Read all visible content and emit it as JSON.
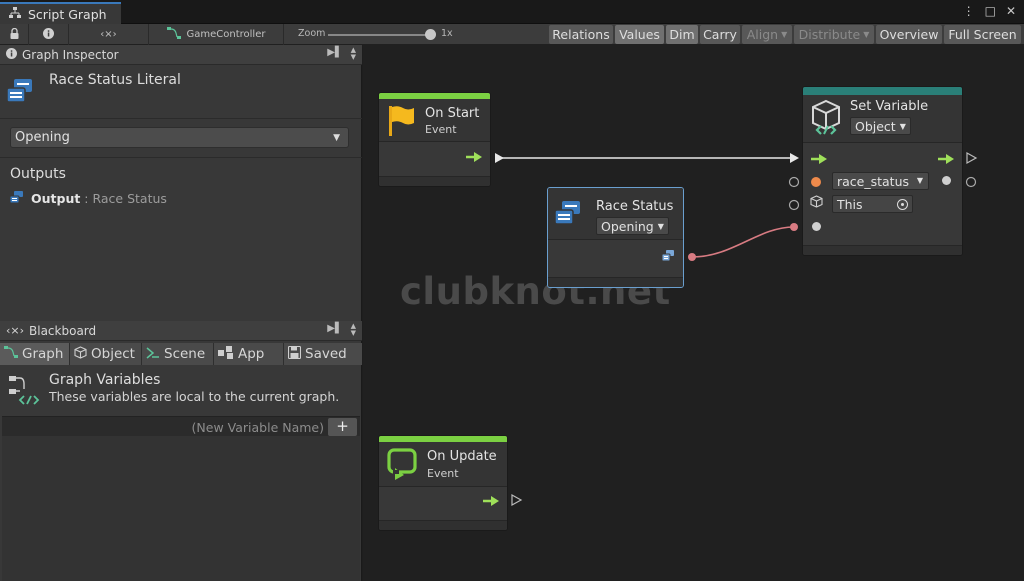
{
  "window": {
    "tab_title": "Script Graph",
    "controls": {
      "more": "⋮",
      "maximize": "□",
      "close": "✕"
    }
  },
  "toolbar": {
    "lock_icon": "lock-icon",
    "info_icon": "info-icon",
    "variables_icon": "‹×›",
    "target_name": "GameController",
    "zoom_label": "Zoom",
    "zoom_value": "1x",
    "buttons": {
      "relations": "Relations",
      "values": "Values",
      "dim": "Dim",
      "carry": "Carry",
      "align": "Align",
      "distribute": "Distribute",
      "overview": "Overview",
      "full_screen": "Full Screen"
    }
  },
  "inspector": {
    "header": "Graph Inspector",
    "title": "Race Status Literal",
    "dropdown_value": "Opening",
    "outputs_label": "Outputs",
    "output_name": "Output",
    "output_type": " : Race Status"
  },
  "blackboard": {
    "header": "Blackboard",
    "tabs": [
      "Graph",
      "Object",
      "Scene",
      "App",
      "Saved"
    ],
    "active_tab": "Graph",
    "section_title": "Graph Variables",
    "section_desc": "These variables are local to the current graph.",
    "new_var_placeholder": "(New Variable Name)",
    "add_label": "+"
  },
  "nodes": {
    "on_start": {
      "title": "On Start",
      "subtitle": "Event"
    },
    "set_variable": {
      "title": "Set Variable",
      "kind": "Object",
      "name": "race_status",
      "target": "This"
    },
    "race_status": {
      "title": "Race Status",
      "value": "Opening"
    },
    "on_update": {
      "title": "On Update",
      "subtitle": "Event"
    }
  },
  "watermark": "clubknot.net",
  "colors": {
    "event_green": "#7bd042",
    "literal_blue": "#3a79bb",
    "set_variable_teal": "#2a7f78",
    "flow_arrow": "#9fe05a",
    "value_wire": "#d87b82",
    "object_port": "#ee8a4b"
  }
}
